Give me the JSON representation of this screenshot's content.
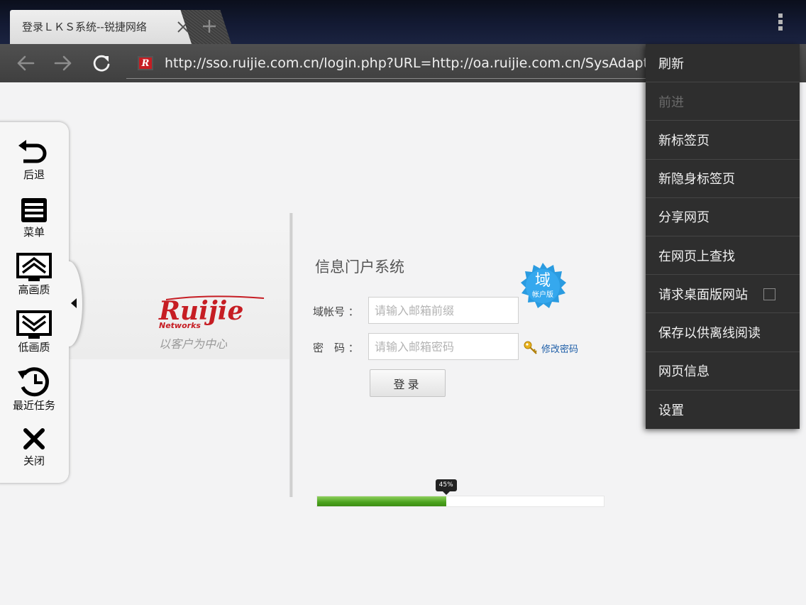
{
  "tab": {
    "title": "登录ＬＫＳ系统--锐捷网络"
  },
  "address_bar": {
    "url": "http://sso.ruijie.com.cn/login.php?URL=http://oa.ruijie.com.cn/SysAdapter.aspx"
  },
  "sidebar": {
    "items": [
      {
        "label": "后退",
        "icon": "undo-arrow-icon"
      },
      {
        "label": "菜单",
        "icon": "menu-list-icon"
      },
      {
        "label": "高画质",
        "icon": "high-quality-icon"
      },
      {
        "label": "低画质",
        "icon": "low-quality-icon"
      },
      {
        "label": "最近任务",
        "icon": "recent-tasks-icon"
      },
      {
        "label": "关闭",
        "icon": "close-x-icon"
      }
    ]
  },
  "page": {
    "logo_text": "Ruijie",
    "logo_subtext": "Networks",
    "slogan": "以客户为中心",
    "portal_title": "信息门户系统",
    "seal": {
      "main": "域",
      "sub": "帐户版"
    },
    "account_label": "域帐号 ：",
    "account_placeholder": "请输入邮箱前缀",
    "password_label": "密　码 ：",
    "password_placeholder": "请输入邮箱密码",
    "change_password": "修改密码",
    "login_button": "登录",
    "progress": {
      "percent": 45,
      "label": "45%"
    }
  },
  "menu": {
    "items": [
      {
        "label": "刷新",
        "enabled": true
      },
      {
        "label": "前进",
        "enabled": false
      },
      {
        "label": "新标签页",
        "enabled": true
      },
      {
        "label": "新隐身标签页",
        "enabled": true
      },
      {
        "label": "分享网页",
        "enabled": true
      },
      {
        "label": "在网页上查找",
        "enabled": true
      },
      {
        "label": "请求桌面版网站",
        "enabled": true,
        "checkbox": false
      },
      {
        "label": "保存以供离线阅读",
        "enabled": true
      },
      {
        "label": "网页信息",
        "enabled": true
      },
      {
        "label": "设置",
        "enabled": true
      }
    ]
  },
  "colors": {
    "progress_green": "#4aa21d",
    "brand_red": "#c61d23",
    "seal_blue": "#2a9be0",
    "link_blue": "#1f5fa8"
  }
}
